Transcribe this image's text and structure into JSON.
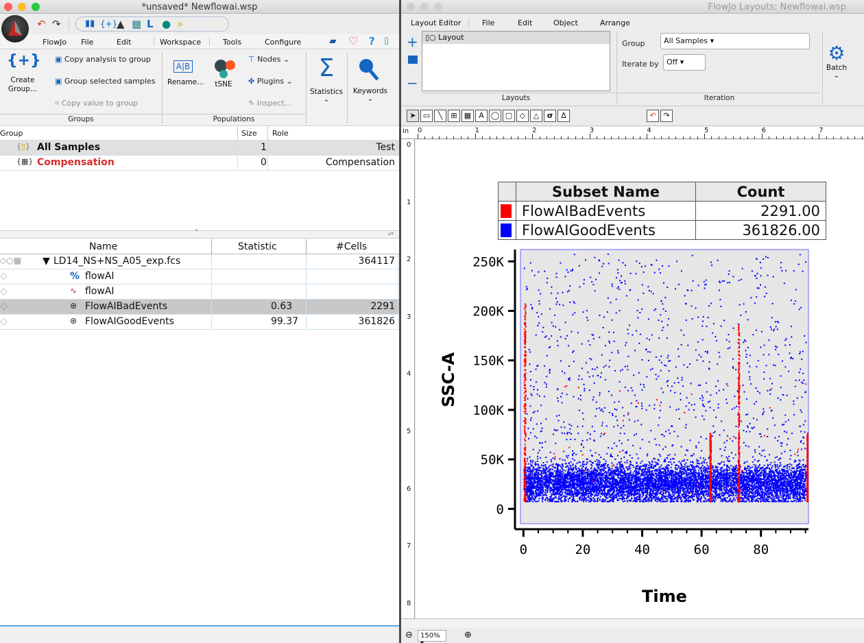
{
  "left_window": {
    "title": "*unsaved* Newflowai.wsp",
    "menu": [
      "FlowJo",
      "File",
      "Edit",
      "Workspace",
      "Tools",
      "Configure"
    ],
    "groups_section": {
      "create_group": "Create\nGroup...",
      "copy_analysis": "Copy analysis to group",
      "group_selected": "Group selected samples",
      "copy_value": "Copy value to group",
      "label": "Groups"
    },
    "populations_section": {
      "rename": "Rename...",
      "tsne": "tSNE",
      "nodes": "Nodes",
      "plugins": "Plugins",
      "inspect": "Inspect...",
      "label": "Populations"
    },
    "statistics": "Statistics",
    "keywords": "Keywords",
    "group_table": {
      "headers": {
        "group": "Group",
        "size": "Size",
        "role": "Role"
      },
      "rows": [
        {
          "name": "All Samples",
          "size": "1",
          "role": "Test"
        },
        {
          "name": "Compensation",
          "size": "0",
          "role": "Compensation"
        }
      ]
    },
    "sample_table": {
      "headers": {
        "name": "Name",
        "statistic": "Statistic",
        "cells": "#Cells"
      },
      "rows": [
        {
          "name": "LD14_NS+NS_A05_exp.fcs",
          "statistic": "",
          "cells": "364117"
        },
        {
          "name": "flowAI",
          "statistic": "",
          "cells": ""
        },
        {
          "name": "flowAI",
          "statistic": "",
          "cells": ""
        },
        {
          "name": "FlowAIBadEvents",
          "statistic": "0.63",
          "cells": "2291"
        },
        {
          "name": "FlowAIGoodEvents",
          "statistic": "99.37",
          "cells": "361826"
        }
      ]
    }
  },
  "right_window": {
    "title": "FlowJo Layouts: Newflowai.wsp",
    "menu": [
      "Layout Editor",
      "File",
      "Edit",
      "Object",
      "Arrange"
    ],
    "layouts_list": [
      "Layout"
    ],
    "layouts_label": "Layouts",
    "group_label": "Group",
    "group_value": "All Samples",
    "iterate_label": "Iterate by",
    "iterate_value": "Off",
    "iteration_label": "Iteration",
    "batch_label": "Batch",
    "zoom": "150%",
    "ruler_unit": "in",
    "ruler_top": [
      "0",
      "1",
      "2",
      "3",
      "4",
      "5",
      "6",
      "7"
    ],
    "ruler_left": [
      "0",
      "1",
      "2",
      "3",
      "4",
      "5",
      "6",
      "7",
      "8"
    ],
    "legend": {
      "headers": {
        "name": "Subset Name",
        "count": "Count"
      },
      "rows": [
        {
          "color": "#ff0000",
          "name": "FlowAIBadEvents",
          "count": "2291.00"
        },
        {
          "color": "#0000ff",
          "name": "FlowAIGoodEvents",
          "count": "361826.00"
        }
      ]
    }
  },
  "chart_data": {
    "type": "scatter",
    "xlabel": "Time",
    "ylabel": "SSC-A",
    "xlim": [
      -1,
      96
    ],
    "ylim": [
      -15000,
      262000
    ],
    "xticks": [
      "0",
      "20",
      "40",
      "60",
      "80"
    ],
    "yticks": [
      "0",
      "50K",
      "100K",
      "150K",
      "200K",
      "250K"
    ],
    "series": [
      {
        "name": "FlowAIBadEvents",
        "color": "#ff0000",
        "count": 2291
      },
      {
        "name": "FlowAIGoodEvents",
        "color": "#0000ff",
        "count": 361826
      }
    ]
  }
}
